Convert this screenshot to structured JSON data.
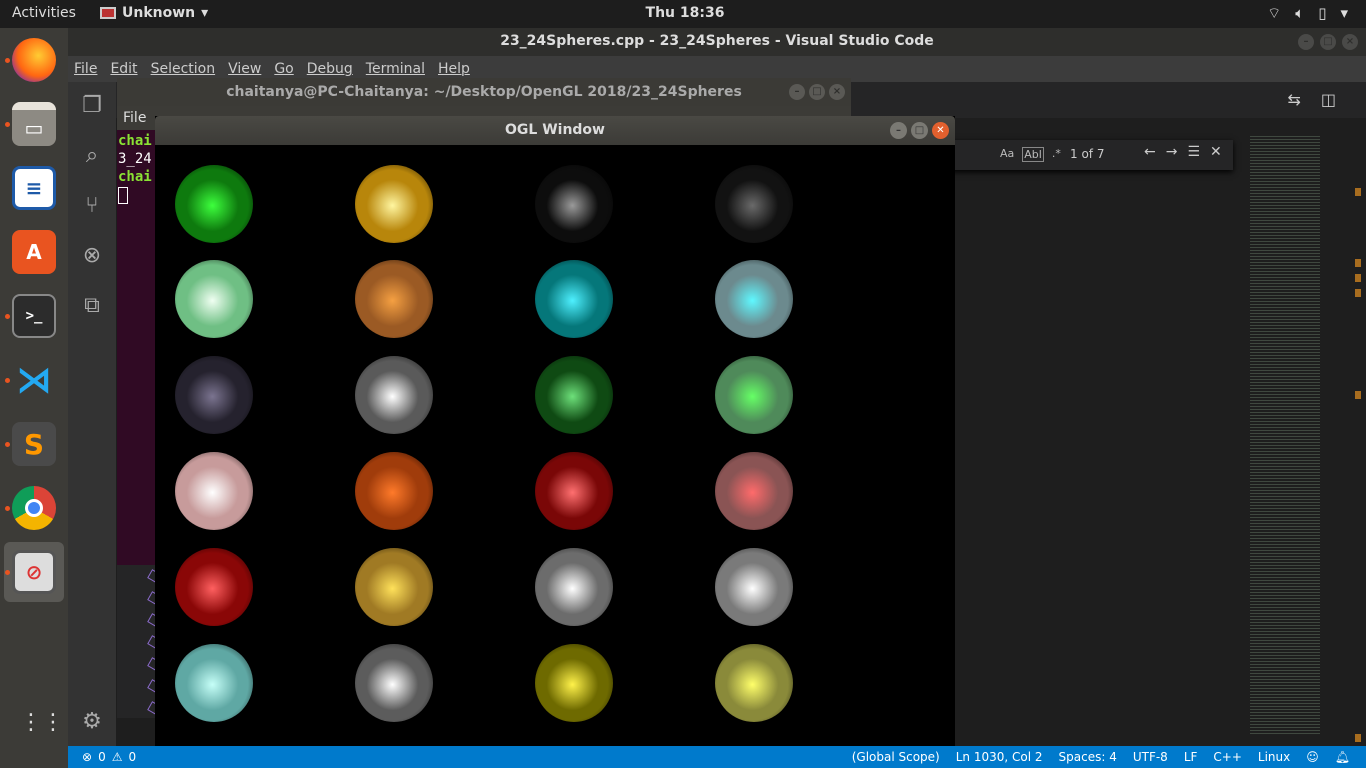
{
  "topbar": {
    "activities": "Activities",
    "app_name": "Unknown",
    "clock": "Thu 18:36"
  },
  "dock": {
    "items": [
      "firefox-icon",
      "files-icon",
      "writer-icon",
      "software-icon",
      "terminal-icon",
      "vscode-icon",
      "sublime-icon",
      "chrome-icon",
      "opengl-app-icon"
    ]
  },
  "vscode": {
    "title": "23_24Spheres.cpp - 23_24Spheres - Visual Studio Code",
    "menu": [
      "File",
      "Edit",
      "Selection",
      "View",
      "Go",
      "Debug",
      "Terminal",
      "Help"
    ],
    "find": {
      "opt_case": "Aa",
      "opt_word": "Abl",
      "opt_regex": ".*",
      "count": "1 of 7"
    },
    "status": {
      "errors": "0",
      "warnings": "0",
      "scope": "(Global Scope)",
      "position": "Ln 1030, Col 2",
      "spaces": "Spaces: 4",
      "encoding": "UTF-8",
      "eol": "LF",
      "language": "C++",
      "platform": "Linux"
    }
  },
  "terminal": {
    "title": "chaitanya@PC-Chaitanya: ~/Desktop/OpenGL 2018/23_24Spheres",
    "menu_file": "File",
    "line1": "chai",
    "line2": "3_24",
    "line3": "chai"
  },
  "ogl": {
    "title": "OGL Window",
    "spheres": [
      {
        "base": "#0e7a0e",
        "spec": "#3dff3d"
      },
      {
        "base": "#b8860b",
        "spec": "#fff6a0"
      },
      {
        "base": "#0d0d0d",
        "spec": "#9a9a9a"
      },
      {
        "base": "#121212",
        "spec": "#6a6a6a"
      },
      {
        "base": "#6fbf84",
        "spec": "#f0fff2"
      },
      {
        "base": "#9b5a24",
        "spec": "#f5a042"
      },
      {
        "base": "#05777a",
        "spec": "#4ef0ff"
      },
      {
        "base": "#6c8a8e",
        "spec": "#5ff8ff"
      },
      {
        "base": "#25222e",
        "spec": "#7b7490"
      },
      {
        "base": "#5a5a5a",
        "spec": "#ffffff"
      },
      {
        "base": "#0f4a13",
        "spec": "#6de07a"
      },
      {
        "base": "#4f8a5a",
        "spec": "#66ff66"
      },
      {
        "base": "#c79b9b",
        "spec": "#ffffff"
      },
      {
        "base": "#a03c0b",
        "spec": "#ff7a2a"
      },
      {
        "base": "#7a0707",
        "spec": "#ff7070"
      },
      {
        "base": "#8a5454",
        "spec": "#ff6b6b"
      },
      {
        "base": "#8a0707",
        "spec": "#ff6060"
      },
      {
        "base": "#a07a24",
        "spec": "#ffe15a"
      },
      {
        "base": "#6c6c6c",
        "spec": "#ffffff"
      },
      {
        "base": "#7a7a7a",
        "spec": "#ffffff"
      },
      {
        "base": "#5fa8a4",
        "spec": "#c6fff8"
      },
      {
        "base": "#5c5c5c",
        "spec": "#ffffff"
      },
      {
        "base": "#6e6a00",
        "spec": "#fff24a"
      },
      {
        "base": "#8a8a3a",
        "spec": "#ffff6a"
      }
    ]
  }
}
